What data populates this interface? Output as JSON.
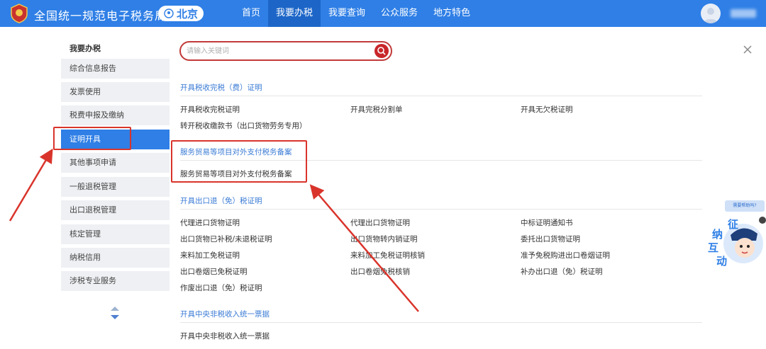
{
  "header": {
    "brand": "全国统一规范电子税务局",
    "city": "北京",
    "nav": [
      "首页",
      "我要办税",
      "我要查询",
      "公众服务",
      "地方特色"
    ],
    "active_nav": 1
  },
  "sidebar": {
    "title": "我要办税",
    "items": [
      "综合信息报告",
      "发票使用",
      "税费申报及缴纳",
      "证明开具",
      "其他事项申请",
      "一般退税管理",
      "出口退税管理",
      "核定管理",
      "纳税信用",
      "涉税专业服务"
    ],
    "active_index": 3
  },
  "search": {
    "placeholder": "请输入关键词"
  },
  "sections": [
    {
      "title": "开具税收完税（费）证明",
      "links": [
        "开具税收完税证明",
        "开具完税分割单",
        "开具无欠税证明",
        "转开税收缴款书（出口货物劳务专用）"
      ]
    },
    {
      "title": "服务贸易等项目对外支付税务备案",
      "links": [
        "服务贸易等项目对外支付税务备案"
      ]
    },
    {
      "title": "开具出口退（免）税证明",
      "links": [
        "代理进口货物证明",
        "代理出口货物证明",
        "中标证明通知书",
        "出口货物已补税/未退税证明",
        "出口货物转内销证明",
        "委托出口货物证明",
        "来料加工免税证明",
        "来料加工免税证明核销",
        "准予免税购进出口卷烟证明",
        "出口卷烟已免税证明",
        "出口卷烟免税核销",
        "补办出口退（免）税证明",
        "作废出口退（免）税证明"
      ]
    },
    {
      "title": "开具中央非税收入统一票据",
      "links": [
        "开具中央非税收入统一票据"
      ]
    }
  ],
  "widget": {
    "help_tab": "需要帮助吗?",
    "chars": [
      "征",
      "纳",
      "互",
      "动"
    ]
  },
  "colors": {
    "primary": "#2f7fe6",
    "highlight": "#d9342b"
  }
}
